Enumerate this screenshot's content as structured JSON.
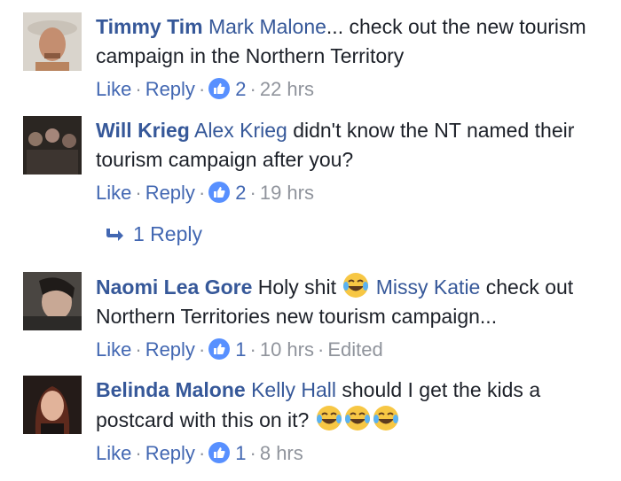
{
  "comments": [
    {
      "author": "Timmy Tim",
      "tag": "Mark Malone",
      "text_before_tag": "",
      "text": "... check out the new tourism campaign in the Northern Territory",
      "like": "Like",
      "reply": "Reply",
      "likes": "2",
      "time": "22 hrs"
    },
    {
      "author": "Will Krieg",
      "tag": "Alex Krieg",
      "text": " didn't know the NT named their tourism campaign after you?",
      "like": "Like",
      "reply": "Reply",
      "likes": "2",
      "time": "19 hrs"
    },
    {
      "author": "Naomi Lea Gore",
      "text_before_tag": " Holy shit ",
      "tag": "Missy Katie",
      "text": " check out Northern Territories new tourism campaign...",
      "like": "Like",
      "reply": "Reply",
      "likes": "1",
      "time": "10 hrs",
      "edited": "Edited"
    },
    {
      "author": "Belinda Malone",
      "tag": "Kelly Hall",
      "text": " should I get the kids a postcard with this on it? ",
      "like": "Like",
      "reply": "Reply",
      "likes": "1",
      "time": "8 hrs"
    }
  ],
  "replies_link": "1 Reply",
  "icons": {
    "like": "thumbs-up-icon",
    "emoji": "tears-of-joy-emoji-icon",
    "reply_arrow": "reply-arrow-icon"
  },
  "colors": {
    "link": "#365899",
    "action": "#4267b2",
    "meta": "#90949c",
    "like_badge": "#5890ff",
    "emoji": "#f7c744"
  }
}
